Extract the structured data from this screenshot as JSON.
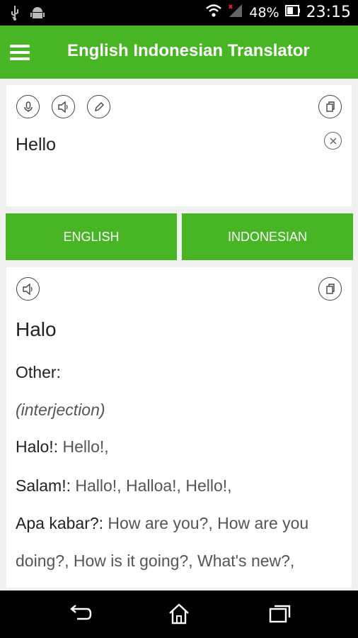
{
  "status_bar": {
    "battery": "48%",
    "time": "23:15"
  },
  "app_bar": {
    "title": "English Indonesian Translator"
  },
  "input_card": {
    "text": "Hello"
  },
  "languages": {
    "source": "ENGLISH",
    "target": "INDONESIAN"
  },
  "output_card": {
    "main_translation": "Halo",
    "other_label": "Other:",
    "part_of_speech": "(interjection)",
    "entries": [
      {
        "term": "Halo!:",
        "meanings": " Hello!,"
      },
      {
        "term": "Salam!:",
        "meanings": " Hallo!, Halloa!, Hello!,"
      },
      {
        "term": "Apa kabar?:",
        "meanings": " How are you?, How are you"
      }
    ],
    "continuation": "doing?, How is it going?, What's new?,"
  },
  "colors": {
    "accent": "#48b624"
  }
}
